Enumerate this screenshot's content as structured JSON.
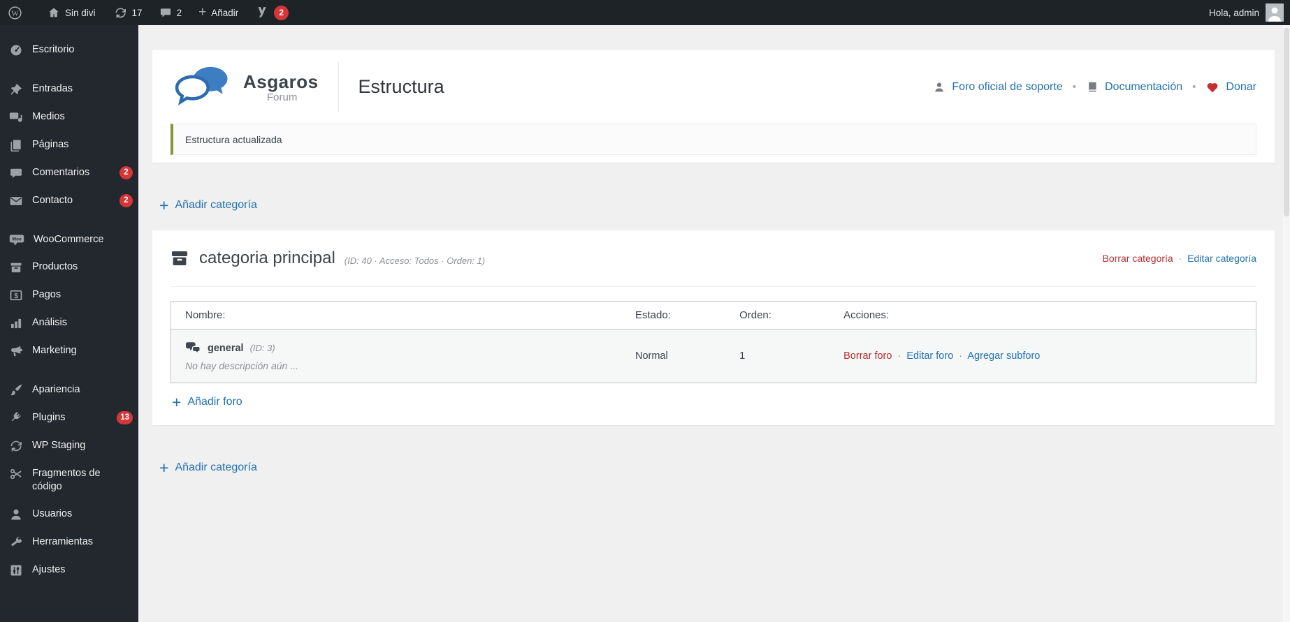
{
  "admin_bar": {
    "site_name": "Sin divi",
    "updates_count": "17",
    "comments_count": "2",
    "add_new_label": "Añadir",
    "yoast_count": "2",
    "greeting": "Hola, admin"
  },
  "sidebar": {
    "items": [
      {
        "label": "Escritorio"
      },
      {
        "label": "Entradas"
      },
      {
        "label": "Medios"
      },
      {
        "label": "Páginas"
      },
      {
        "label": "Comentarios",
        "badge": "2"
      },
      {
        "label": "Contacto",
        "badge": "2"
      },
      {
        "label": "WooCommerce"
      },
      {
        "label": "Productos"
      },
      {
        "label": "Pagos"
      },
      {
        "label": "Análisis"
      },
      {
        "label": "Marketing"
      },
      {
        "label": "Apariencia"
      },
      {
        "label": "Plugins",
        "badge": "13"
      },
      {
        "label": "WP Staging"
      },
      {
        "label": "Fragmentos de código"
      },
      {
        "label": "Usuarios"
      },
      {
        "label": "Herramientas"
      },
      {
        "label": "Ajustes"
      }
    ]
  },
  "header": {
    "brand_name": "Asgaros",
    "brand_sub": "Forum",
    "page_title": "Estructura",
    "support_link": "Foro oficial de soporte",
    "docs_link": "Documentación",
    "donate_link": "Donar",
    "bullet": "•",
    "notice": "Estructura actualizada"
  },
  "content": {
    "add_category_label": "Añadir categoría",
    "plus": "+",
    "separator": "·",
    "category": {
      "name": "categoria principal",
      "meta": "(ID: 40 · Acceso: Todos · Orden: 1)",
      "delete_label": "Borrar categoría",
      "edit_label": "Editar categoría",
      "table": {
        "headers": [
          "Nombre:",
          "Estado:",
          "Orden:",
          "Acciones:"
        ],
        "rows": [
          {
            "name": "general",
            "id_meta": "(ID: 3)",
            "description": "No hay descripción aún ...",
            "status": "Normal",
            "order": "1",
            "actions": [
              "Borrar foro",
              "Editar foro",
              "Agregar subforo"
            ]
          }
        ]
      },
      "add_forum_label": "Añadir foro"
    }
  },
  "colors": {
    "accent_blue": "#2271b1",
    "danger_red": "#b32d2e",
    "badge_red": "#d63638",
    "notice_border_olive": "#87943c",
    "heart_red": "#c62f2f",
    "admin_bar_bg": "#1d2327",
    "sidebar_bg": "#23282e",
    "content_bg": "#f0f0f1"
  }
}
